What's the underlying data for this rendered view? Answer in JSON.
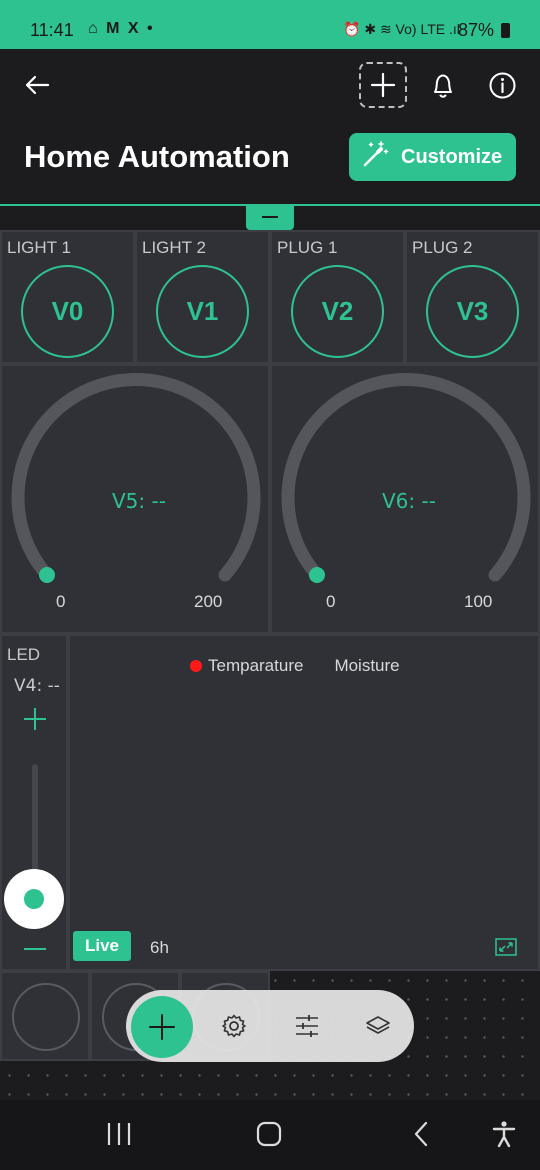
{
  "status_bar": {
    "time": "11:41",
    "left_icons": "⌂ M X •",
    "right_icons": "⏰ ✱ ≋ Vo) LTE .ıl",
    "battery": "87%"
  },
  "header": {
    "title": "Home Automation",
    "customize_label": "Customize"
  },
  "buttons": [
    {
      "label": "LIGHT 1",
      "pin": "V0"
    },
    {
      "label": "LIGHT 2",
      "pin": "V1"
    },
    {
      "label": "PLUG 1",
      "pin": "V2"
    },
    {
      "label": "PLUG 2",
      "pin": "V3"
    }
  ],
  "gauges": [
    {
      "value_text": "V5: --",
      "min": "0",
      "max": "200"
    },
    {
      "value_text": "V6: --",
      "min": "0",
      "max": "100"
    }
  ],
  "led": {
    "label": "LED",
    "value_text": "V4: --"
  },
  "chart": {
    "legend": [
      {
        "name": "Temparature",
        "color": "#ff1a1a"
      },
      {
        "name": "Moisture",
        "color": ""
      }
    ],
    "live_label": "Live",
    "range_label": "6h"
  },
  "colors": {
    "accent": "#2ec290",
    "tile_bg": "#303137",
    "background": "#1c1c1f"
  }
}
